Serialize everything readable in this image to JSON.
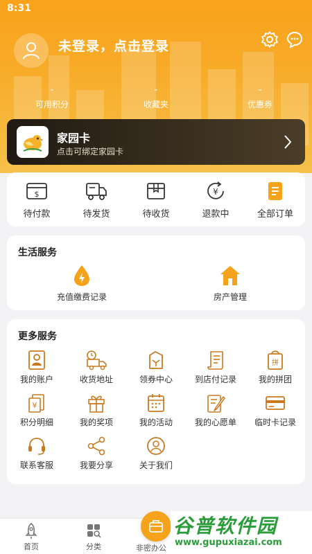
{
  "status_bar": {
    "time": "8:31"
  },
  "header": {
    "login_text": "未登录，点击登录",
    "stats": [
      {
        "value": "-",
        "label": "可用积分"
      },
      {
        "value": "-",
        "label": "收藏夹"
      },
      {
        "value": "-",
        "label": "优惠券"
      }
    ]
  },
  "family_card": {
    "title": "家园卡",
    "subtitle": "点击可绑定家园卡"
  },
  "orders": [
    {
      "label": "待付款",
      "icon": "wallet-icon"
    },
    {
      "label": "待发货",
      "icon": "truck-icon"
    },
    {
      "label": "待收货",
      "icon": "box-icon"
    },
    {
      "label": "退款中",
      "icon": "refund-icon"
    },
    {
      "label": "全部订单",
      "icon": "order-list-icon"
    }
  ],
  "life_services": {
    "title": "生活服务",
    "items": [
      {
        "label": "充值缴费记录",
        "icon": "drop-bolt-icon"
      },
      {
        "label": "房产管理",
        "icon": "house-icon"
      }
    ]
  },
  "more_services": {
    "title": "更多服务",
    "items": [
      {
        "label": "我的账户",
        "icon": "account-icon"
      },
      {
        "label": "收货地址",
        "icon": "delivery-icon"
      },
      {
        "label": "领券中心",
        "icon": "coupon-icon"
      },
      {
        "label": "到店付记录",
        "icon": "receipt-icon"
      },
      {
        "label": "我的拼团",
        "icon": "group-buy-icon"
      },
      {
        "label": "积分明细",
        "icon": "points-icon"
      },
      {
        "label": "我的奖项",
        "icon": "gift-icon"
      },
      {
        "label": "我的活动",
        "icon": "calendar-icon"
      },
      {
        "label": "我的心愿单",
        "icon": "wishlist-icon"
      },
      {
        "label": "临时卡记录",
        "icon": "card-icon"
      },
      {
        "label": "联系客服",
        "icon": "headset-icon"
      },
      {
        "label": "我要分享",
        "icon": "share-icon"
      },
      {
        "label": "关于我们",
        "icon": "about-icon"
      }
    ]
  },
  "bottom_nav": {
    "home": "首页",
    "category": "分类",
    "center": "非密办公"
  },
  "watermark": {
    "main": "谷普软件园",
    "url": "www.gupuxiazai.com"
  },
  "colors": {
    "accent": "#f7a21b",
    "card_dark": "#2b241a"
  }
}
